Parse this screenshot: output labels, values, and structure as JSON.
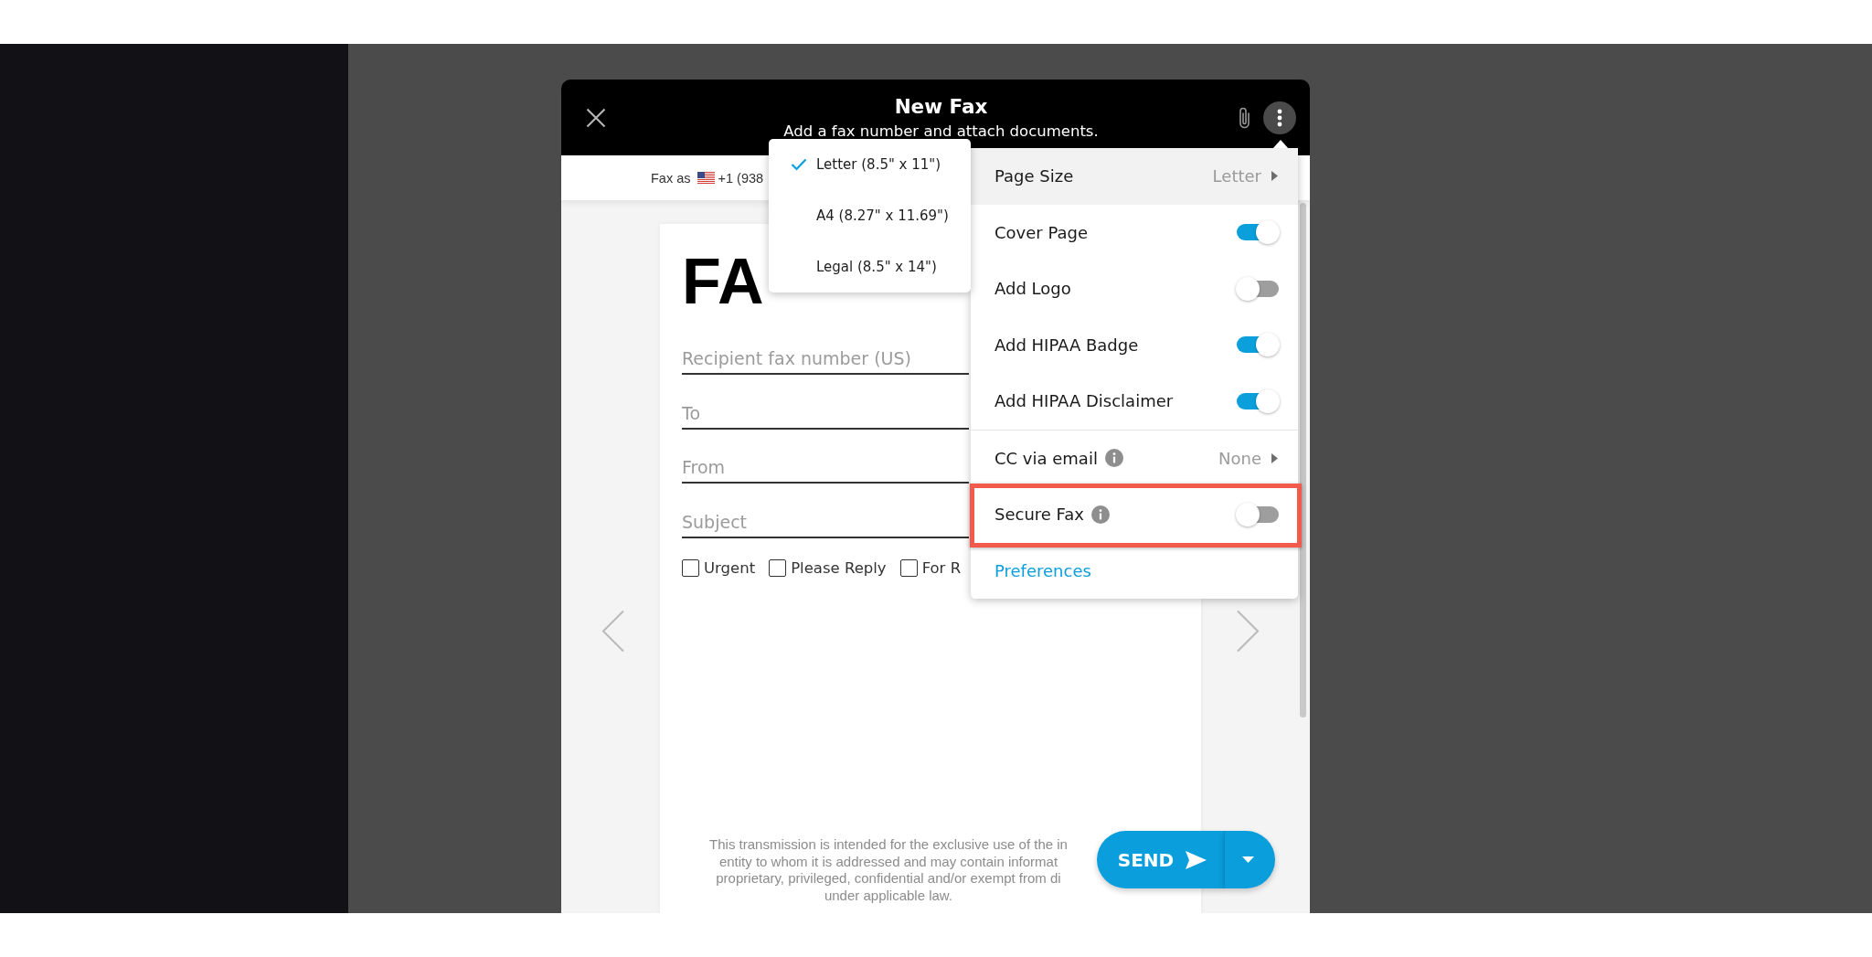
{
  "modal": {
    "title": "New Fax",
    "subtitle": "Add a fax number and attach documents."
  },
  "sender_bar": {
    "label": "Fax as",
    "number": "+1 (938"
  },
  "page_size_menu": {
    "options": [
      {
        "label": "Letter (8.5\" x 11\")",
        "selected": true
      },
      {
        "label": "A4 (8.27\" x 11.69\")",
        "selected": false
      },
      {
        "label": "Legal (8.5\" x 14\")",
        "selected": false
      }
    ]
  },
  "options_menu": {
    "sections": [
      {
        "items": [
          {
            "kind": "submenu",
            "label": "Page Size",
            "value": "Letter",
            "active": true,
            "info": false,
            "highlighted": false
          },
          {
            "kind": "toggle",
            "label": "Cover Page",
            "on": true,
            "active": false,
            "info": false,
            "highlighted": false
          },
          {
            "kind": "toggle",
            "label": "Add Logo",
            "on": false,
            "active": false,
            "info": false,
            "highlighted": false
          },
          {
            "kind": "toggle",
            "label": "Add HIPAA Badge",
            "on": true,
            "active": false,
            "info": false,
            "highlighted": false
          },
          {
            "kind": "toggle",
            "label": "Add HIPAA Disclaimer",
            "on": true,
            "active": false,
            "info": false,
            "highlighted": false
          }
        ]
      },
      {
        "items": [
          {
            "kind": "submenu",
            "label": "CC via email",
            "value": "None",
            "active": false,
            "info": true,
            "highlighted": false
          },
          {
            "kind": "toggle",
            "label": "Secure Fax",
            "on": false,
            "active": false,
            "info": true,
            "highlighted": true
          },
          {
            "kind": "link",
            "label": "Preferences",
            "active": false,
            "info": false,
            "highlighted": false
          }
        ]
      }
    ]
  },
  "document": {
    "heading": "FA",
    "fields": [
      {
        "placeholder": "Recipient fax number (US)"
      },
      {
        "placeholder": "To"
      },
      {
        "placeholder": "From"
      },
      {
        "placeholder": "Subject"
      }
    ],
    "checkboxes": [
      {
        "label": "Urgent",
        "checked": false
      },
      {
        "label": "Please Reply",
        "checked": false
      },
      {
        "label": "For R",
        "checked": false
      }
    ],
    "disclaimer_lines": [
      "This transmission is intended for the exclusive use of the in",
      "entity to whom it is addressed and may contain informat",
      "proprietary, privileged, confidential and/or exempt from di",
      "under applicable law."
    ]
  },
  "send_button": {
    "label": "SEND"
  }
}
